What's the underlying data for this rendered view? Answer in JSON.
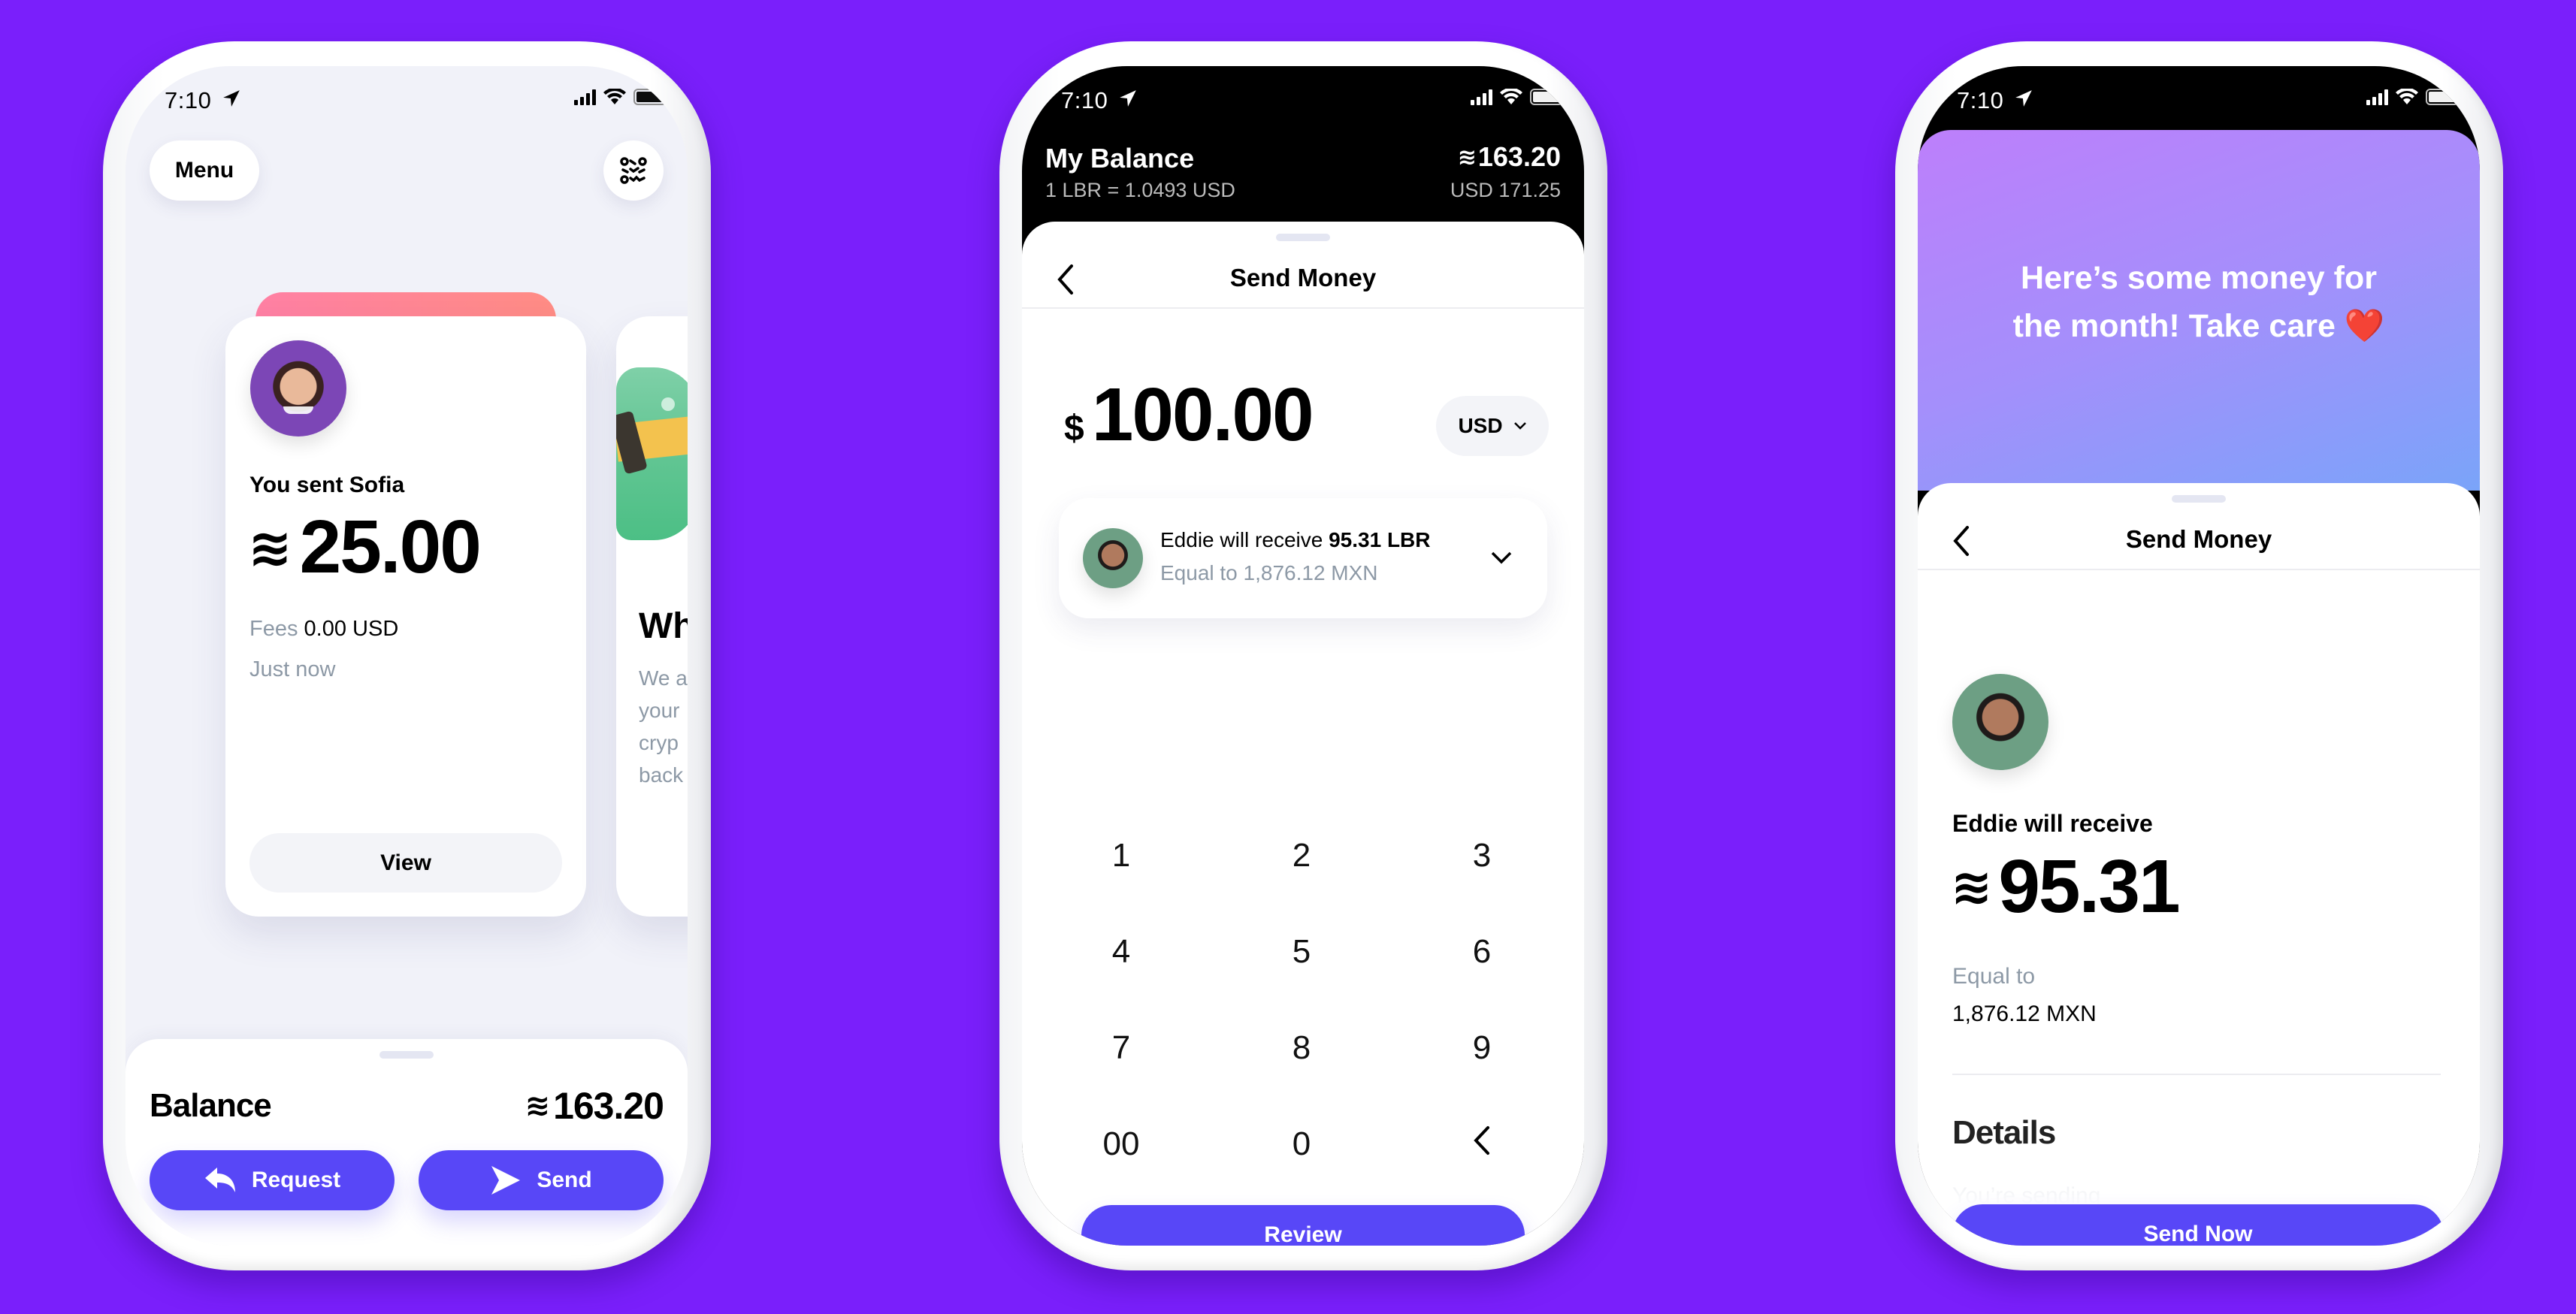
{
  "colors": {
    "background": "#7a1ffb",
    "primary_button": "#5847f7",
    "muted_text": "#8d99a6",
    "card_gradient_start": "#ff80a4",
    "card_gradient_end": "#ff8c84",
    "message_gradient_start": "#bd7ffb",
    "message_gradient_end": "#7aa4f9"
  },
  "status_bar": {
    "time": "7:10",
    "location_icon": "location-arrow-icon",
    "signal_icon": "cellular-signal-icon",
    "wifi_icon": "wifi-icon",
    "battery_icon": "battery-icon"
  },
  "screen_home": {
    "menu_label": "Menu",
    "qr_icon": "qr-scan-icon",
    "transaction_card": {
      "title": "You sent Sofia",
      "currency_symbol": "≋",
      "amount": "25.00",
      "fees_label": "Fees",
      "fees_value": "0.00 USD",
      "time": "Just now",
      "view_label": "View"
    },
    "promo_card": {
      "title_partial": "Wh",
      "body_lines": [
        "We a",
        "your",
        "cryp",
        "back"
      ]
    },
    "balance_sheet": {
      "label": "Balance",
      "currency_symbol": "≋",
      "amount": "163.20",
      "request_label": "Request",
      "send_label": "Send"
    }
  },
  "screen_send": {
    "header": {
      "title": "My Balance",
      "rate": "1 LBR = 1.0493 USD",
      "currency_symbol": "≋",
      "balance": "163.20",
      "balance_usd": "USD 171.25"
    },
    "nav_title": "Send Money",
    "amount_symbol": "$",
    "amount": "100.00",
    "currency_selector": "USD",
    "recipient": {
      "text": "Eddie will receive",
      "amount": "95.31 LBR",
      "equivalent": "Equal to 1,876.12 MXN"
    },
    "keypad": [
      "1",
      "2",
      "3",
      "4",
      "5",
      "6",
      "7",
      "8",
      "9",
      "00",
      "0",
      "‹"
    ],
    "review_label": "Review"
  },
  "screen_confirm": {
    "message": "Here’s some money for the month! Take care ❤️",
    "message_line1": "Here’s some money for",
    "message_line2": "the month! Take care",
    "heart": "❤️",
    "nav_title": "Send Money",
    "receive_label": "Eddie will receive",
    "currency_symbol": "≋",
    "amount": "95.31",
    "equal_label": "Equal to",
    "equal_value": "1,876.12 MXN",
    "details_title": "Details",
    "details_first_row": "You’re sending",
    "send_now_label": "Send Now"
  }
}
